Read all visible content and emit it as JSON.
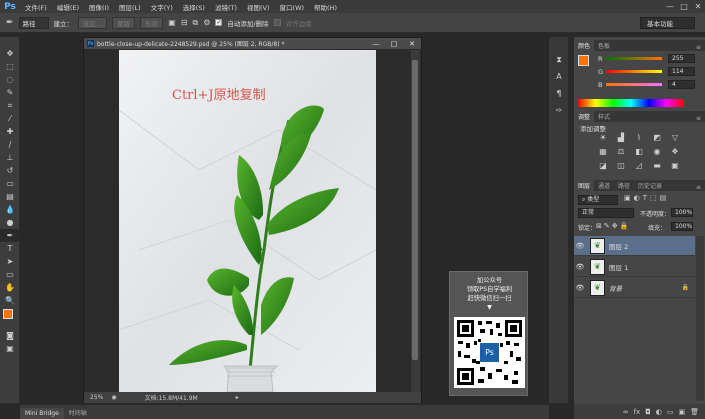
{
  "app": {
    "logo": "Ps"
  },
  "menu": [
    "文件(F)",
    "编辑(E)",
    "图像(I)",
    "图层(L)",
    "文字(Y)",
    "选择(S)",
    "滤镜(T)",
    "视图(V)",
    "窗口(W)",
    "帮助(H)"
  ],
  "window_controls": {
    "minimize": "—",
    "maximize": "□",
    "close": "✕"
  },
  "options": {
    "mode_value": "路径",
    "build_label": "建立：",
    "selection_btn": "选区...",
    "mask_btn": "蒙版",
    "shape_btn": "形状",
    "auto_add_delete": "自动添加/删除",
    "align_edges": "对齐边缘",
    "workspace": "基本功能"
  },
  "document": {
    "title": "bottle-close-up-delicate-2248529.psd @ 25% (图层 2, RGB/8) *",
    "canvas_text": "Ctrl+J原地复制",
    "zoom": "25%",
    "doc_size": "文档:15.8M/41.9M"
  },
  "qr_overlay": {
    "line1": "加公众号",
    "line2": "领取PS自学福利",
    "line3": "赶快微信扫一扫",
    "arrow": "▼",
    "center_logo": "Ps"
  },
  "color_panel": {
    "tabs": [
      "颜色",
      "色板"
    ],
    "r_label": "R",
    "g_label": "G",
    "b_label": "B",
    "r": "255",
    "g": "114",
    "b": "4",
    "foreground": "#ff7204"
  },
  "adjustments_panel": {
    "tabs": [
      "调整",
      "样式"
    ],
    "title": "添加调整"
  },
  "layers_panel": {
    "tabs": [
      "图层",
      "通道",
      "路径",
      "历史记录"
    ],
    "kind": "类型",
    "blend_mode": "正常",
    "opacity_label": "不透明度：",
    "opacity": "100%",
    "lock_label": "锁定：",
    "fill_label": "填充：",
    "fill": "100%",
    "layers": [
      {
        "name": "图层 2",
        "selected": true
      },
      {
        "name": "图层 1",
        "selected": false
      },
      {
        "name": "背景",
        "selected": false
      }
    ]
  },
  "bottom_tabs": [
    "Mini Bridge",
    "时间轴"
  ],
  "colors": {
    "accent": "#5fb7ff",
    "foreground_swatch": "#ff7204",
    "selected_layer": "#5b6f8a"
  }
}
